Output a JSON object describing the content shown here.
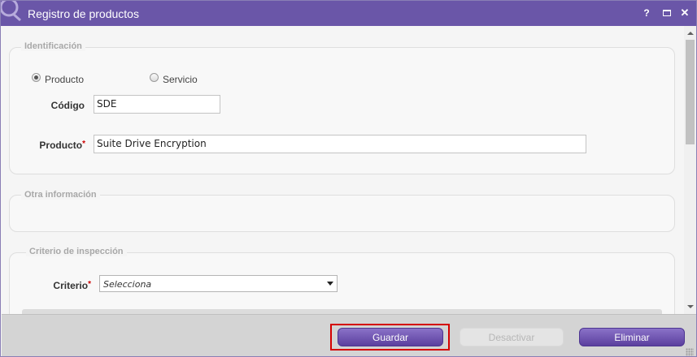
{
  "window": {
    "title": "Registro de productos",
    "help_label": "?",
    "close_label": "✕",
    "accent_color": "#6a56a8"
  },
  "sections": {
    "identificacion": {
      "legend": "Identificación",
      "radio_options": [
        "Producto",
        "Servicio"
      ],
      "selected_option": "Producto",
      "codigo_label": "Código",
      "codigo_value": "SDE",
      "producto_label": "Producto",
      "producto_value": "Suite Drive Encryption",
      "required_mark": "*"
    },
    "otra_informacion": {
      "legend": "Otra información"
    },
    "criterio_inspeccion": {
      "legend": "Criterio de inspección",
      "criterio_label": "Criterio",
      "criterio_value": "Selecciona"
    }
  },
  "footer": {
    "guardar_label": "Guardar",
    "desactivar_label": "Desactivar",
    "eliminar_label": "Eliminar",
    "highlight_color": "#d40000"
  },
  "icons": {
    "logo": "app-logo-icon",
    "help": "help-icon",
    "maximize": "maximize-icon",
    "close": "close-icon",
    "dropdown": "chevron-down-icon"
  }
}
